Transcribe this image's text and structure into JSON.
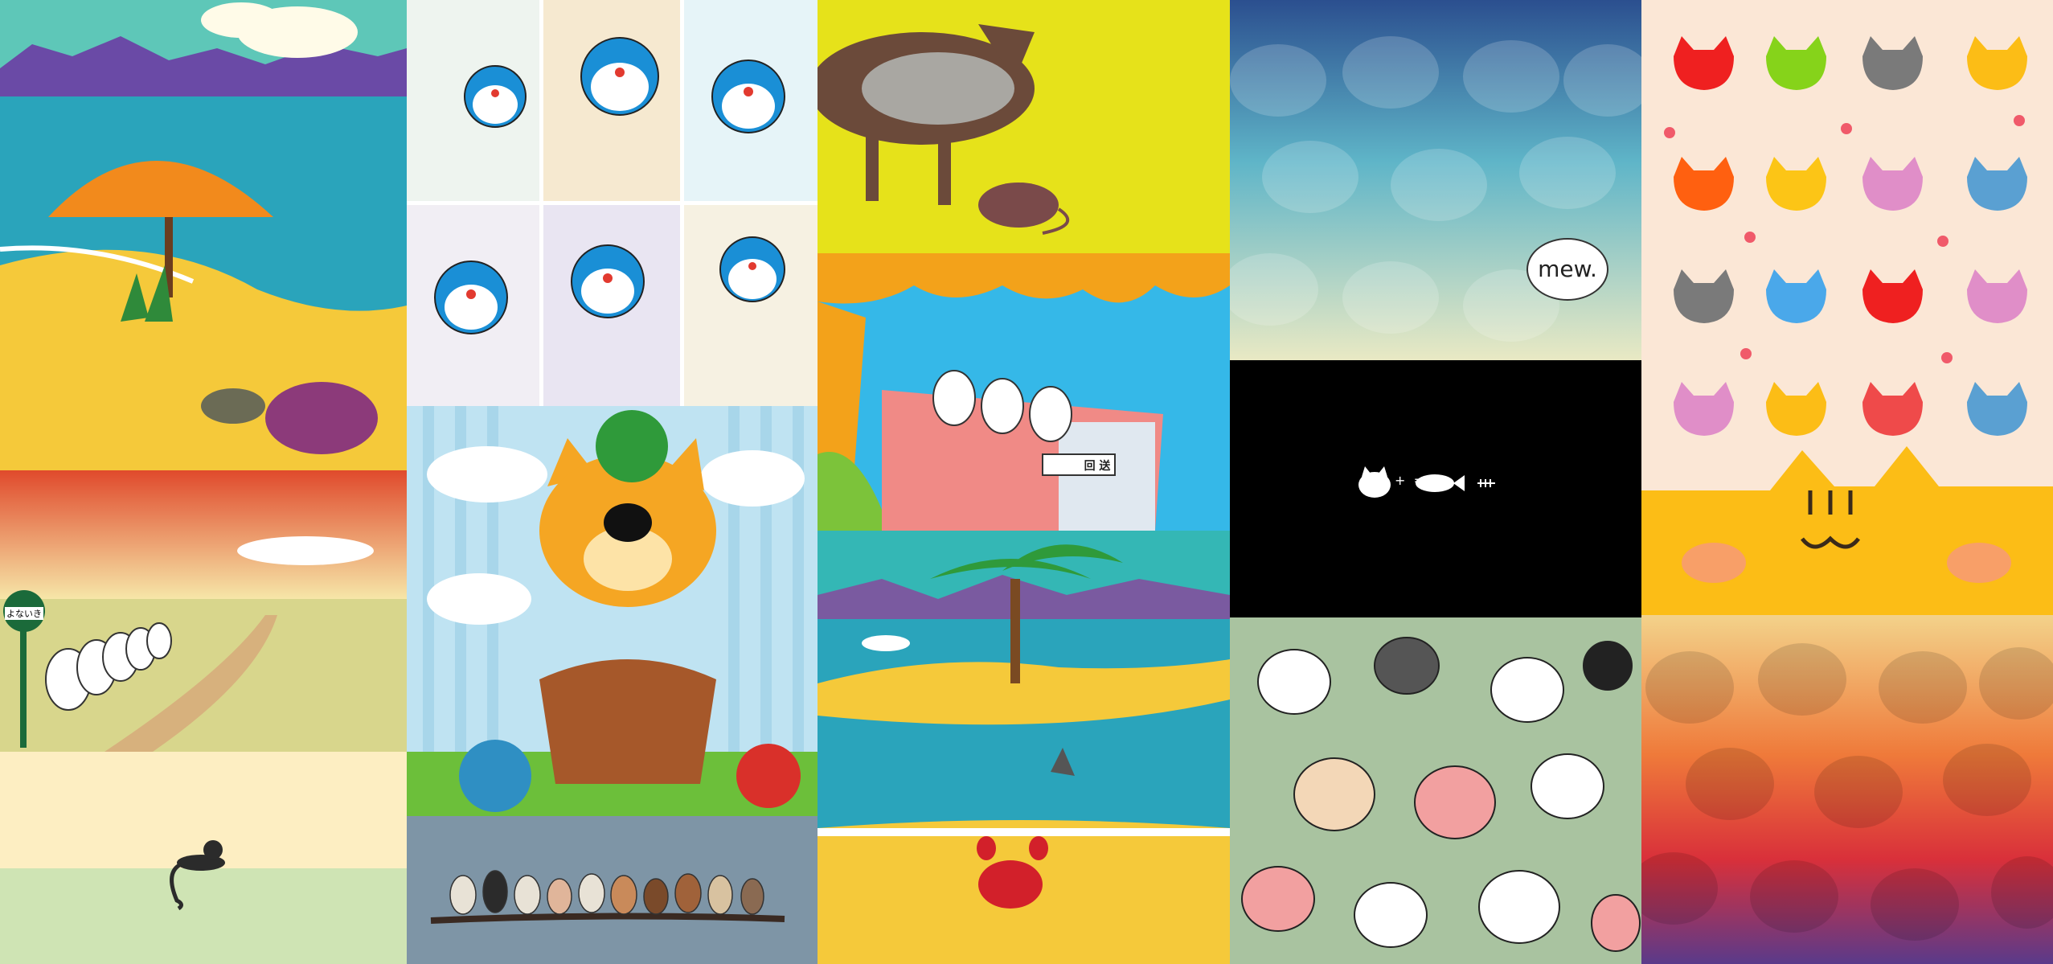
{
  "gallery": {
    "tiles": [
      {
        "id": "clay-beach-turtle",
        "icon": "clay-beach-turtle-thumbnail"
      },
      {
        "id": "cats-bus-stop",
        "icon": "cats-bus-stop-thumbnail",
        "sign_text": "よないき"
      },
      {
        "id": "black-cat-minimal",
        "icon": "black-cat-minimal-thumbnail"
      },
      {
        "id": "doraemon-grid",
        "icon": "doraemon-grid-thumbnail"
      },
      {
        "id": "cat-yarn-basket",
        "icon": "cat-yarn-basket-thumbnail"
      },
      {
        "id": "owls-branch",
        "icon": "owls-branch-thumbnail"
      },
      {
        "id": "mechanical-cat-mouse",
        "icon": "mechanical-cat-mouse-thumbnail"
      },
      {
        "id": "cats-on-bus",
        "icon": "cats-on-bus-thumbnail",
        "sign_text": "回 送"
      },
      {
        "id": "clay-island-crab",
        "icon": "clay-island-crab-thumbnail"
      },
      {
        "id": "mew-cats-blue",
        "icon": "mew-cats-blue-thumbnail",
        "bubble_text": "mew."
      },
      {
        "id": "cat-plus-fish",
        "icon": "cat-plus-fish-thumbnail",
        "equation": "+  ="
      },
      {
        "id": "cats-pattern",
        "icon": "cats-pattern-thumbnail"
      },
      {
        "id": "cat-faces-grid",
        "icon": "cat-faces-grid-thumbnail"
      },
      {
        "id": "rainbow-cats",
        "icon": "rainbow-cats-thumbnail"
      }
    ]
  },
  "colors": {
    "ocean": "#2aa4bb",
    "sand": "#f5c93a",
    "yellow_bg": "#e6e21a",
    "sky": "#35b8e8",
    "black_bg": "#000000",
    "cream": "#fbe7d6",
    "cat_yellow": "#fcbd16"
  }
}
